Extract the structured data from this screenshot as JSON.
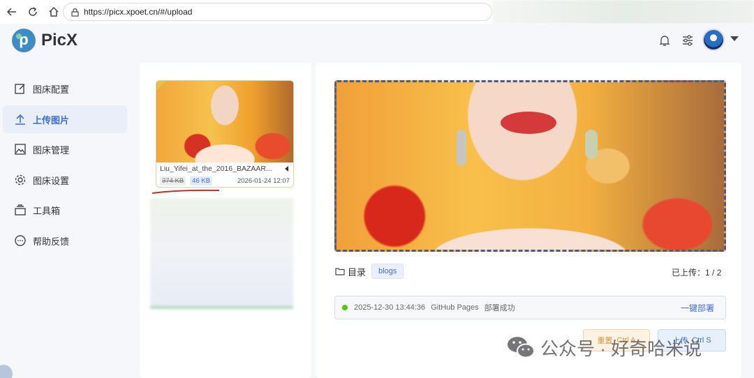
{
  "browser": {
    "url": "https://picx.xpoet.cn/#/upload"
  },
  "header": {
    "app_name": "PicX"
  },
  "sidebar": {
    "items": [
      {
        "label": "图床配置",
        "icon": "edit-icon",
        "active": false
      },
      {
        "label": "上传图片",
        "icon": "upload-icon",
        "active": true
      },
      {
        "label": "图床管理",
        "icon": "image-icon",
        "active": false
      },
      {
        "label": "图床设置",
        "icon": "gear-icon",
        "active": false
      },
      {
        "label": "工具箱",
        "icon": "toolbox-icon",
        "active": false
      },
      {
        "label": "帮助反馈",
        "icon": "chat-icon",
        "active": false
      }
    ]
  },
  "upload_list": {
    "item": {
      "file_name": "Liu_Yifei_at_the_2016_BAZAAR...",
      "size_original": "374 KB",
      "size_compressed": "46 KB",
      "date": "2026-01-24 12:07"
    }
  },
  "main": {
    "dir_label": "目录",
    "dir_tag": "blogs",
    "uploaded_label": "已上传：",
    "uploaded_count": "1 / 2",
    "deploy": {
      "time": "2025-12-30 13:44:36",
      "target": "GitHub Pages",
      "status": "部署成功",
      "button": "一键部署"
    },
    "reset_button": {
      "label": "重置",
      "shortcut": "Ctrl A"
    },
    "upload_button": {
      "label": "上传",
      "shortcut": "Ctrl S"
    }
  },
  "watermark": {
    "text": "公众号 · 好奇哈米说"
  },
  "colors": {
    "accent": "#3b6fd4",
    "success": "#52c41a",
    "reset": "#d49a3a"
  }
}
